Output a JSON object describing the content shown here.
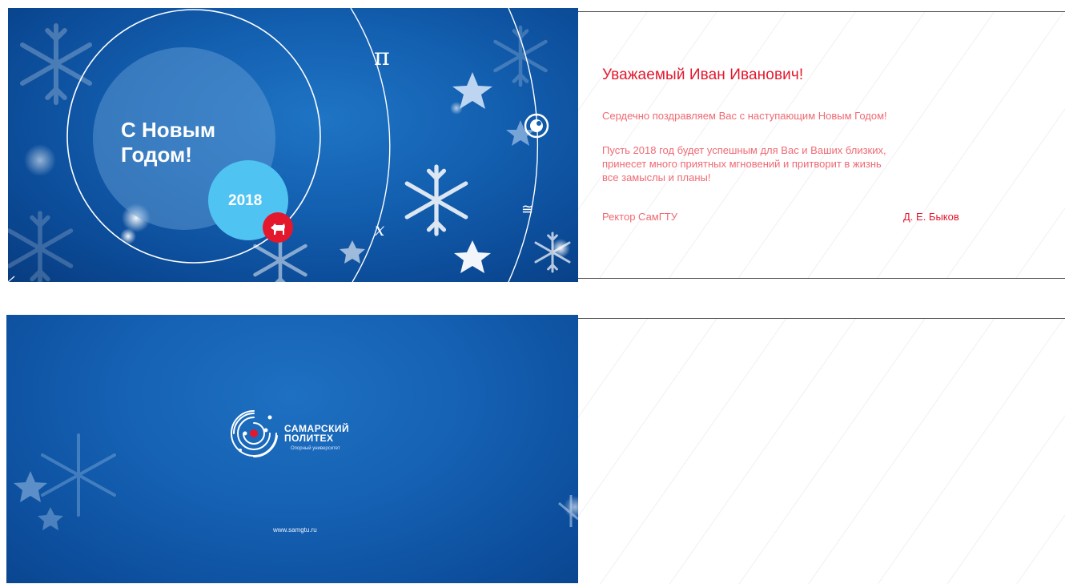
{
  "front": {
    "title_line1": "С Новым",
    "title_line2": "Годом!",
    "year": "2018",
    "symbol_pi": "π",
    "symbol_x": "x",
    "symbol_approx": "≅",
    "dog_icon": "dog-icon",
    "atom_icon": "atom-icon"
  },
  "letter": {
    "salutation": "Уважаемый Иван Иванович!",
    "line1": "Сердечно поздравляем Вас с наступающим Новым Годом!",
    "line2a": "Пусть 2018 год будет успешным для Вас и Ваших близких,",
    "line2b": "принесет много приятных мгновений и притворит в жизнь",
    "line2c": "все замыслы и планы!",
    "signer_title": "Ректор СамГТУ",
    "signer_name": "Д. Е. Быков"
  },
  "back": {
    "logo_line1": "САМАРСКИЙ",
    "logo_line2": "ПОЛИТЕХ",
    "logo_sub": "Опорный университет",
    "url": "www.samgtu.ru"
  },
  "colors": {
    "blue": "#135fb0",
    "red": "#e3182d",
    "pink": "#ef6a73",
    "cyan": "#4fc3f2"
  }
}
